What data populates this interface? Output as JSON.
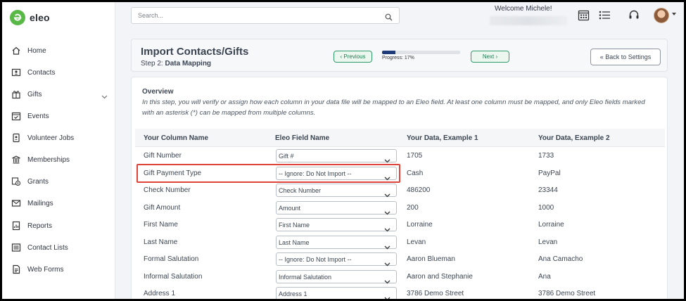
{
  "app": {
    "logo_text": "eleo",
    "brand_color": "#59b947",
    "accent_color": "#1f7d52"
  },
  "sidebar": {
    "items": [
      {
        "label": "Home",
        "icon": "home-icon"
      },
      {
        "label": "Contacts",
        "icon": "contact-card-icon"
      },
      {
        "label": "Gifts",
        "icon": "gift-icon",
        "expandable": true
      },
      {
        "label": "Events",
        "icon": "calendar-check-icon"
      },
      {
        "label": "Volunteer Jobs",
        "icon": "badge-icon"
      },
      {
        "label": "Memberships",
        "icon": "building-icon"
      },
      {
        "label": "Grants",
        "icon": "grant-icon"
      },
      {
        "label": "Mailings",
        "icon": "envelope-icon"
      },
      {
        "label": "Reports",
        "icon": "report-icon"
      },
      {
        "label": "Contact Lists",
        "icon": "list-icon"
      },
      {
        "label": "Web Forms",
        "icon": "form-icon"
      }
    ]
  },
  "header": {
    "search_placeholder": "Search...",
    "welcome": "Welcome Michele!",
    "icons": [
      "calendar-icon",
      "task-list-icon",
      "headset-icon",
      "avatar"
    ]
  },
  "title_card": {
    "title": "Import Contacts/Gifts",
    "step_prefix": "Step 2:",
    "step_name": "Data Mapping",
    "previous_label": "Previous",
    "next_label": "Next",
    "progress_percent": 17,
    "progress_label": "Progress: 17%",
    "back_label": "Back to Settings"
  },
  "overview": {
    "title": "Overview",
    "text": "In this step, you will verify or assign how each column in your data file will be mapped to an Eleo field. At least one column must be mapped, and only Eleo fields marked with an asterisk (*) can be mapped from multiple columns."
  },
  "table": {
    "headers": [
      "Your Column Name",
      "Eleo Field Name",
      "Your Data, Example 1",
      "Your Data, Example 2"
    ],
    "rows": [
      {
        "column": "Gift Number",
        "field": "Gift #",
        "ex1": "1705",
        "ex2": "1733"
      },
      {
        "column": "Gift Payment Type",
        "field": "-- Ignore: Do Not Import --",
        "ex1": "Cash",
        "ex2": "PayPal",
        "highlighted": true
      },
      {
        "column": "Check Number",
        "field": "Check Number",
        "ex1": "486200",
        "ex2": "23344"
      },
      {
        "column": "Gift Amount",
        "field": "Amount",
        "ex1": "200",
        "ex2": "1000"
      },
      {
        "column": "First Name",
        "field": "First Name",
        "ex1": "Lorraine",
        "ex2": "Lorraine"
      },
      {
        "column": "Last Name",
        "field": "Last Name",
        "ex1": "Levan",
        "ex2": "Levan"
      },
      {
        "column": "Formal Salutation",
        "field": "-- Ignore: Do Not Import --",
        "ex1": "Aaron Blueman",
        "ex2": "Ana Camacho"
      },
      {
        "column": "Informal Salutation",
        "field": "Informal Salutation",
        "ex1": "Aaron and Stephanie",
        "ex2": "Ana"
      },
      {
        "column": "Address 1",
        "field": "Address 1",
        "ex1": "3786 Demo Street",
        "ex2": "3786 Demo Street"
      }
    ]
  }
}
